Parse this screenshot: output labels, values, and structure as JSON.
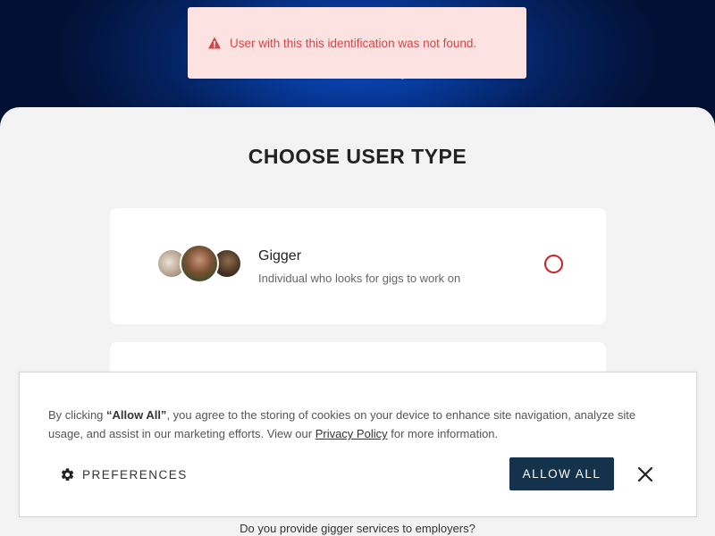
{
  "toast": {
    "icon": "warning-icon",
    "message": "User with this this identification was not found.",
    "color": "#d64545",
    "background": "#fde2e2"
  },
  "page": {
    "title": "CHOOSE USER TYPE"
  },
  "user_types": [
    {
      "name": "Gigger",
      "description": "Individual who looks for gigs to work on",
      "selected": false
    }
  ],
  "cookie_banner": {
    "text_before": "By clicking ",
    "emphasis": "“Allow All”",
    "text_middle": ", you agree to the storing of cookies on your device to enhance site navigation, analyze site usage, and assist in our marketing efforts. View our ",
    "link": "Privacy Policy",
    "text_after": " for more information.",
    "preferences_label": "PREFERENCES",
    "allow_all_label": "ALLOW ALL",
    "allow_all_color": "#14324b"
  },
  "footer": {
    "question": "Do you provide gigger services to employers?"
  },
  "colors": {
    "hero": "#04215e",
    "radio": "#cc1f1f"
  }
}
